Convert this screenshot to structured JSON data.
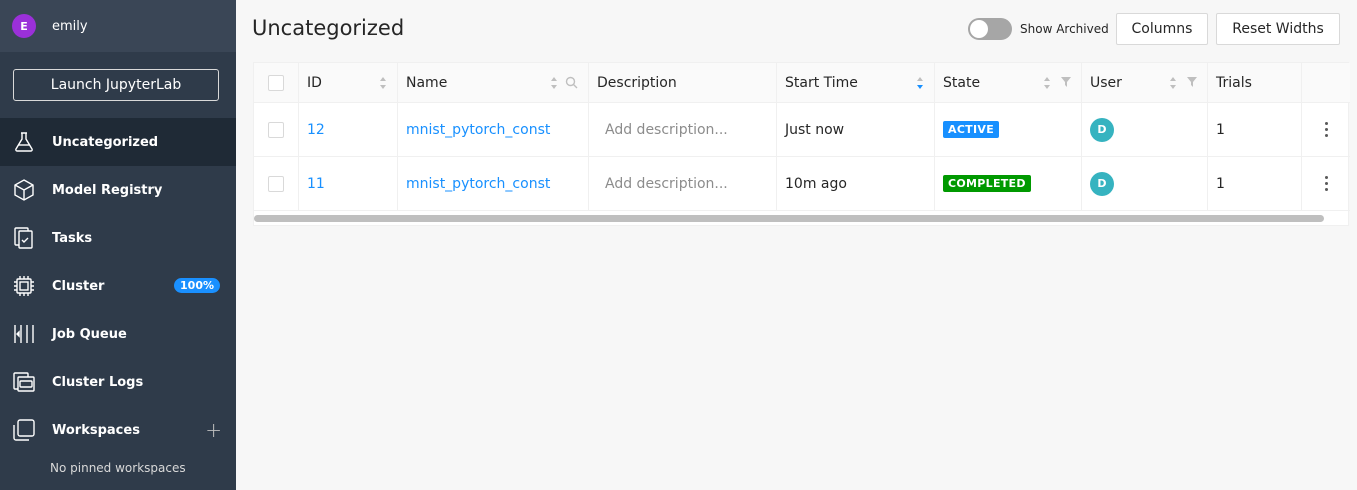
{
  "user": {
    "initial": "E",
    "name": "emily",
    "avatar_color": "#9b30d9"
  },
  "sidebar": {
    "launch_label": "Launch JupyterLab",
    "items": [
      {
        "label": "Uncategorized",
        "icon": "flask-icon",
        "active": true
      },
      {
        "label": "Model Registry",
        "icon": "cube-icon"
      },
      {
        "label": "Tasks",
        "icon": "tasks-icon"
      },
      {
        "label": "Cluster",
        "icon": "chip-icon",
        "badge": "100%"
      },
      {
        "label": "Job Queue",
        "icon": "queue-icon"
      },
      {
        "label": "Cluster Logs",
        "icon": "logs-icon"
      },
      {
        "label": "Workspaces",
        "icon": "workspaces-icon",
        "action": "plus-icon"
      }
    ],
    "no_pinned": "No pinned workspaces"
  },
  "main": {
    "title": "Uncategorized",
    "show_archived": "Show Archived",
    "columns_label": "Columns",
    "reset_label": "Reset Widths"
  },
  "table": {
    "headers": {
      "id": "ID",
      "name": "Name",
      "description": "Description",
      "start_time": "Start Time",
      "state": "State",
      "user": "User",
      "trials": "Trials"
    },
    "rows": [
      {
        "id": "12",
        "name": "mnist_pytorch_const",
        "description": "Add description...",
        "start_time": "Just now",
        "state": "ACTIVE",
        "state_color": "#1890ff",
        "user_initial": "D",
        "trials": "1"
      },
      {
        "id": "11",
        "name": "mnist_pytorch_const",
        "description": "Add description...",
        "start_time": "10m ago",
        "state": "COMPLETED",
        "state_color": "#009900",
        "user_initial": "D",
        "trials": "1"
      }
    ]
  },
  "colors": {
    "sidebar_bg": "#2f3b4a",
    "accent": "#1890ff",
    "cluster_badge": "#1a90ff",
    "user_avatar": "#36b3c0"
  }
}
